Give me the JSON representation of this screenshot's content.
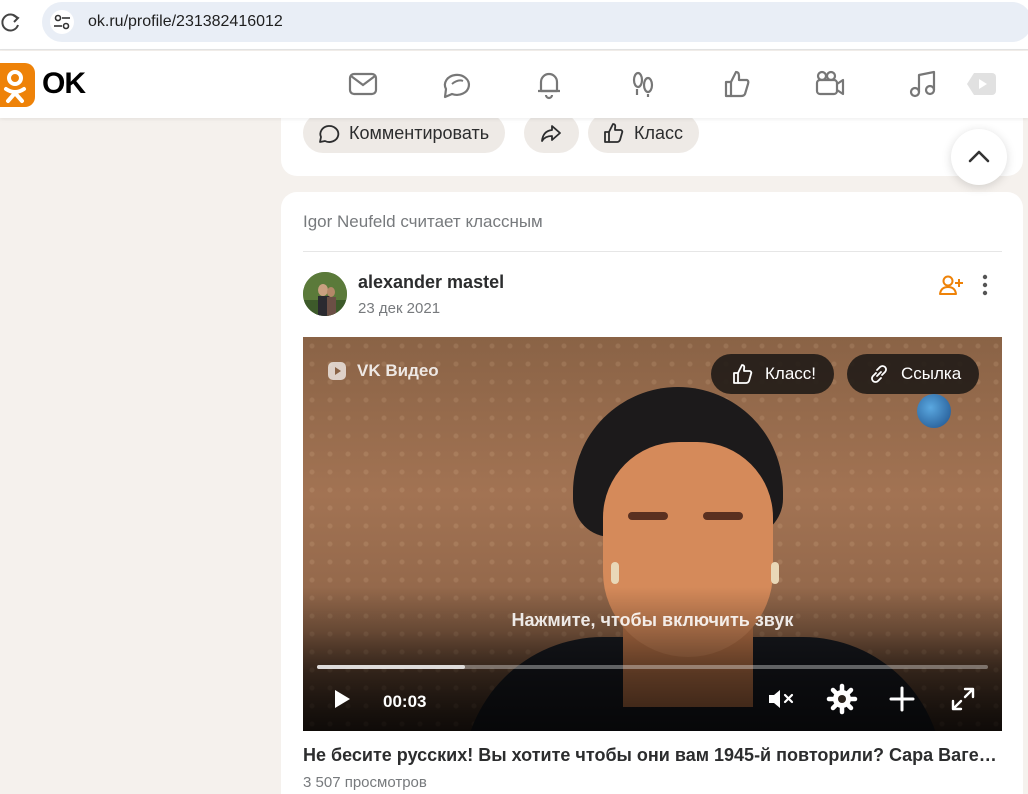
{
  "browser": {
    "url": "ok.ru/profile/231382416012"
  },
  "header": {
    "logo_text": "OK",
    "nav_icons": [
      "messages-icon",
      "discussions-icon",
      "notifications-icon",
      "guests-icon",
      "marks-icon",
      "video-icon",
      "music-icon",
      "video-feed-icon"
    ],
    "accent_color": "#ee8208"
  },
  "prev_post": {
    "comment_label": "Комментировать",
    "like_label": "Класс"
  },
  "post": {
    "liked_by_text": "Igor Neufeld считает классным",
    "author": "alexander mastel",
    "date": "23 дек 2021",
    "video": {
      "source_label": "VK Видео",
      "like_button": "Класс!",
      "link_button": "Ссылка",
      "sound_hint": "Нажмите, чтобы включить звук",
      "time": "00:03",
      "progress": 0.22,
      "muted": true
    },
    "title": "Не бесите русских! Вы хотите чтобы они вам 1945-й повторили? Сара Вагенкнехт",
    "views": "3 507 просмотров"
  }
}
